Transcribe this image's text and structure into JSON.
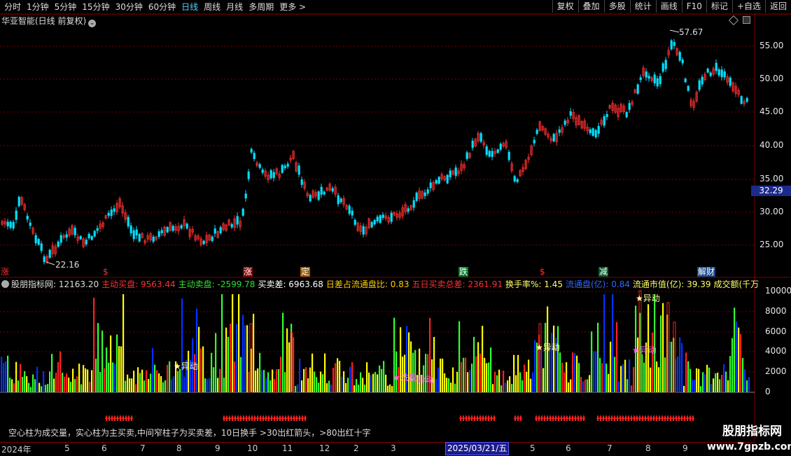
{
  "toolbar": {
    "periods": [
      "分时",
      "1分钟",
      "5分钟",
      "15分钟",
      "30分钟",
      "60分钟",
      "日线",
      "周线",
      "月线",
      "多周期",
      "更多"
    ],
    "active": "日线",
    "right": [
      "复权",
      "叠加",
      "多股",
      "统计",
      "画线",
      "F10",
      "标记",
      "+自选",
      "返回"
    ]
  },
  "main": {
    "title": "华亚智能(日线 前复权)",
    "circle_icon": "chevron-down-icon",
    "price_ticks": [
      "55.00",
      "50.00",
      "45.00",
      "40.00",
      "35.00",
      "30.00",
      "25.00"
    ],
    "current_price": "32.29",
    "high_label": "57.67",
    "low_label": "22.16"
  },
  "markers": [
    {
      "text": "涨",
      "color": "#ff3030"
    },
    {
      "text": "$",
      "color": "#ff3030"
    },
    {
      "text": "涨",
      "color": "#ffffff",
      "bg": "#8a0000"
    },
    {
      "text": "定",
      "color": "#ffffff",
      "bg": "#9a5a00"
    },
    {
      "text": "跌",
      "color": "#ffffff",
      "bg": "#007a2a"
    },
    {
      "text": "$",
      "color": "#ff3030"
    },
    {
      "text": "减",
      "color": "#ffffff",
      "bg": "#005a2a"
    },
    {
      "text": "解财",
      "color": "#ffffff",
      "bg": "#1a4a8a"
    }
  ],
  "indicator": {
    "name": "股朋指标网",
    "value": ": 12163.20",
    "items": [
      {
        "label": "主动买盘: 9563.44",
        "color": "#ff3030"
      },
      {
        "label": "主动卖盘: -2599.78",
        "color": "#33dd33"
      },
      {
        "label": "买卖差: 6963.68",
        "color": "#ffffff"
      },
      {
        "label": "日差占流通盘比: 0.83",
        "color": "#ffcc00"
      },
      {
        "label": "五日买卖总差: 2361.91",
        "color": "#ff3030"
      },
      {
        "label": "换手率%: 1.45",
        "color": "#ffff66"
      },
      {
        "label": "流通盘(亿): 0.84",
        "color": "#3366ff"
      },
      {
        "label": "流通市值(亿): 39.39",
        "color": "#ffff66"
      },
      {
        "label": "成交额(千万",
        "color": "#ffff66"
      }
    ],
    "y_ticks": [
      "10000",
      "8000",
      "6000",
      "4000",
      "2000",
      "0"
    ],
    "annotations": [
      "★异动",
      "★洗盘",
      "异动",
      "★异动",
      "★异动",
      "★异动"
    ]
  },
  "note": "空心柱为成交量，实心柱为主买卖,中间窄柱子为买卖差，10日换手 >30出红箭头，>80出红十字",
  "x_axis": {
    "labels": [
      "2024年",
      "5",
      "6",
      "7",
      "8",
      "9",
      "10",
      "11",
      "12",
      "2",
      "3",
      "5",
      "6",
      "7",
      "8",
      "9",
      "10"
    ],
    "date_box": "2025/03/21/五"
  },
  "watermark": {
    "line1": "股朋指标网",
    "line2": "www.7gpzb.com"
  },
  "colors": {
    "up": "#ff3030",
    "down": "#00e0ff",
    "grid": "#7a0000"
  }
}
